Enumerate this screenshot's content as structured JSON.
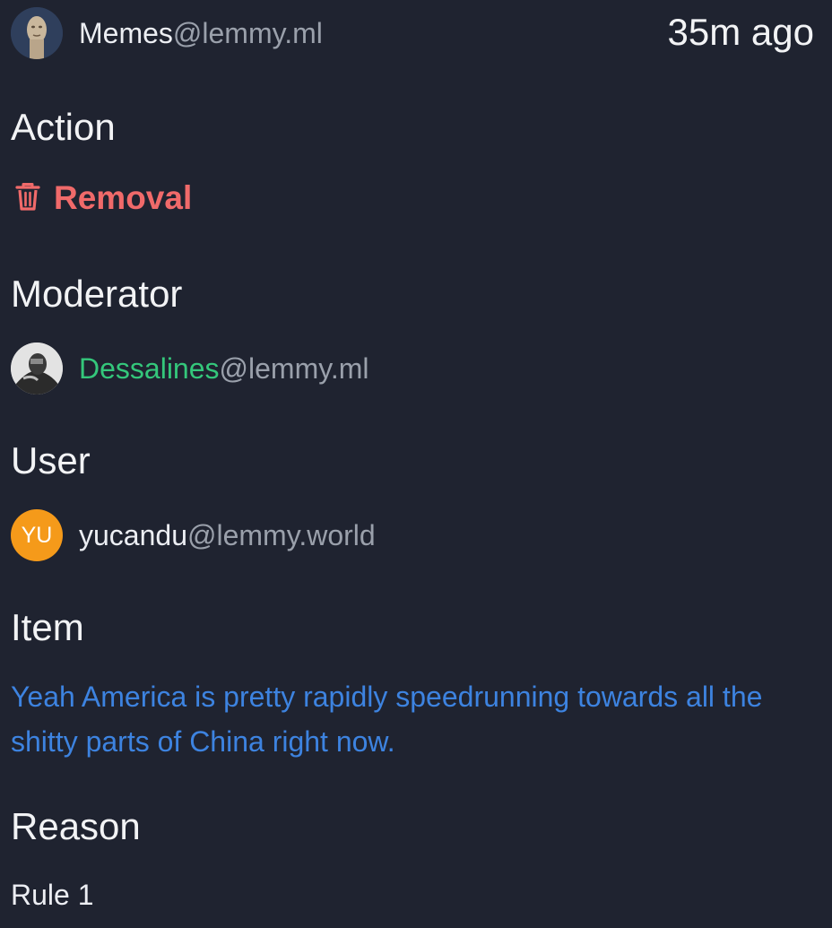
{
  "community": {
    "name": "Memes",
    "instance": "@lemmy.ml",
    "avatar_icon": "community-face-avatar"
  },
  "timestamp": "35m ago",
  "sections": {
    "action_heading": "Action",
    "moderator_heading": "Moderator",
    "user_heading": "User",
    "item_heading": "Item",
    "reason_heading": "Reason"
  },
  "action": {
    "label": "Removal",
    "icon": "trash-icon",
    "color": "#f06a6a"
  },
  "moderator": {
    "name": "Dessalines",
    "instance": "@lemmy.ml",
    "color": "#34c77b"
  },
  "user": {
    "initials": "YU",
    "name": "yucandu",
    "instance": "@lemmy.world",
    "avatar_color": "#f59a1a"
  },
  "item": {
    "text": "Yeah America is pretty rapidly speedrunning towards all the shitty parts of China right now.",
    "color": "#3d83e0"
  },
  "reason": {
    "text": "Rule 1"
  }
}
